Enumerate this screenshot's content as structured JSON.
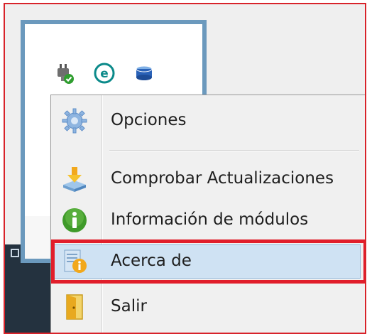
{
  "tray": {
    "icons": [
      "power-plug-check-icon",
      "eset-icon",
      "disk-drive-icon"
    ]
  },
  "menu": {
    "items": [
      {
        "label": "Opciones",
        "icon": "gear-icon"
      },
      {
        "label": "Comprobar Actualizaciones",
        "icon": "download-update-icon"
      },
      {
        "label": "Información de módulos",
        "icon": "info-green-icon"
      },
      {
        "label": "Acerca de",
        "icon": "about-info-icon",
        "highlighted": true
      },
      {
        "label": "Salir",
        "icon": "exit-door-icon"
      }
    ]
  },
  "colors": {
    "highlight_bg": "#cfe2f3",
    "annotation_red": "#e11e2b",
    "popup_border": "#6b99bd",
    "eset_teal": "#0b8a8a"
  }
}
